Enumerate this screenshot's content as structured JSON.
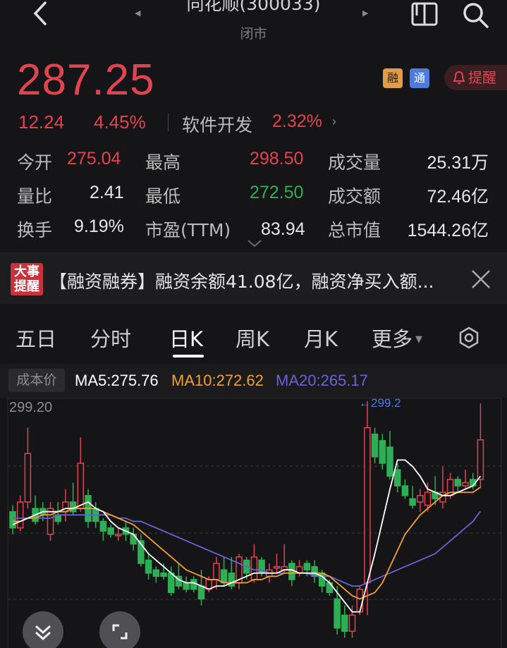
{
  "header": {
    "title": "同花顺(300033)",
    "status": "闭市"
  },
  "quote": {
    "price": "287.25",
    "change": "12.24",
    "change_pct": "4.45%",
    "industry": "软件开发",
    "industry_pct": "2.32%",
    "industry_arrow": "›",
    "tags": {
      "margin": "融",
      "connect": "通"
    },
    "remind_label": "提醒"
  },
  "stats": {
    "open_label": "今开",
    "open": "275.04",
    "high_label": "最高",
    "high": "298.50",
    "volume_label": "成交量",
    "volume": "25.31万",
    "vol_ratio_label": "量比",
    "vol_ratio": "2.41",
    "low_label": "最低",
    "low": "272.50",
    "amount_label": "成交额",
    "amount": "72.46亿",
    "turnover_label": "换手",
    "turnover": "9.19%",
    "pe_label": "市盈(TTM)",
    "pe": "83.94",
    "mcap_label": "总市值",
    "mcap": "1544.26亿"
  },
  "notice": {
    "badge_line1": "大事",
    "badge_line2": "提醒",
    "text": "【融资融券】融资余额41.08亿，融资净买入额..."
  },
  "tabs": [
    "五日",
    "分时",
    "日K",
    "周K",
    "月K",
    "更多"
  ],
  "indicators": {
    "cost_label": "成本价",
    "ma5": "MA5:275.76",
    "ma10": "MA10:272.62",
    "ma20": "MA20:265.17",
    "colors": {
      "ma5": "#ffffff",
      "ma10": "#f0a030",
      "ma20": "#6a62d8",
      "up": "#e14451",
      "down": "#2eae55"
    }
  },
  "chart_data": {
    "type": "candlestick",
    "y_top_label": "299.20",
    "high_marker": "299.2",
    "grid": true,
    "candles": [
      {
        "o": 265,
        "c": 260,
        "h": 267,
        "l": 258
      },
      {
        "o": 260,
        "c": 268,
        "h": 270,
        "l": 259
      },
      {
        "o": 268,
        "c": 283,
        "h": 291,
        "l": 266
      },
      {
        "o": 266,
        "c": 262,
        "h": 270,
        "l": 261
      },
      {
        "o": 266,
        "c": 264,
        "h": 268,
        "l": 262
      },
      {
        "o": 258,
        "c": 266,
        "h": 268,
        "l": 256
      },
      {
        "o": 264,
        "c": 262,
        "h": 268,
        "l": 261
      },
      {
        "o": 265,
        "c": 268,
        "h": 272,
        "l": 262
      },
      {
        "o": 268,
        "c": 265,
        "h": 274,
        "l": 264
      },
      {
        "o": 266,
        "c": 280,
        "h": 288,
        "l": 265
      },
      {
        "o": 270,
        "c": 262,
        "h": 272,
        "l": 260
      },
      {
        "o": 266,
        "c": 262,
        "h": 268,
        "l": 260
      },
      {
        "o": 262,
        "c": 259,
        "h": 263,
        "l": 256
      },
      {
        "o": 260,
        "c": 258,
        "h": 261,
        "l": 257
      },
      {
        "o": 258,
        "c": 258,
        "h": 260,
        "l": 256
      },
      {
        "o": 260,
        "c": 258,
        "h": 262,
        "l": 256
      },
      {
        "o": 258,
        "c": 255,
        "h": 260,
        "l": 253
      },
      {
        "o": 256,
        "c": 249,
        "h": 258,
        "l": 248
      },
      {
        "o": 250,
        "c": 246,
        "h": 252,
        "l": 244
      },
      {
        "o": 247,
        "c": 245,
        "h": 248,
        "l": 243
      },
      {
        "o": 246,
        "c": 245,
        "h": 249,
        "l": 244
      },
      {
        "o": 246,
        "c": 240,
        "h": 248,
        "l": 239
      },
      {
        "o": 245,
        "c": 242,
        "h": 249,
        "l": 241
      },
      {
        "o": 243,
        "c": 241,
        "h": 245,
        "l": 240
      },
      {
        "o": 244,
        "c": 241,
        "h": 245,
        "l": 240
      },
      {
        "o": 242,
        "c": 238,
        "h": 247,
        "l": 236
      },
      {
        "o": 241,
        "c": 244,
        "h": 245,
        "l": 240
      },
      {
        "o": 244,
        "c": 249,
        "h": 251,
        "l": 241
      },
      {
        "o": 247,
        "c": 243,
        "h": 251,
        "l": 242
      },
      {
        "o": 246,
        "c": 242,
        "h": 251,
        "l": 241
      },
      {
        "o": 243,
        "c": 251,
        "h": 252,
        "l": 241
      },
      {
        "o": 250,
        "c": 246,
        "h": 251,
        "l": 244
      },
      {
        "o": 244,
        "c": 251,
        "h": 255,
        "l": 243
      },
      {
        "o": 250,
        "c": 246,
        "h": 251,
        "l": 245
      },
      {
        "o": 245,
        "c": 247,
        "h": 249,
        "l": 243
      },
      {
        "o": 248,
        "c": 248,
        "h": 252,
        "l": 246
      },
      {
        "o": 247,
        "c": 248,
        "h": 255,
        "l": 246
      },
      {
        "o": 249,
        "c": 244,
        "h": 250,
        "l": 242
      },
      {
        "o": 246,
        "c": 248,
        "h": 250,
        "l": 245
      },
      {
        "o": 249,
        "c": 247,
        "h": 250,
        "l": 245
      },
      {
        "o": 248,
        "c": 245,
        "h": 250,
        "l": 243
      },
      {
        "o": 246,
        "c": 242,
        "h": 247,
        "l": 240
      },
      {
        "o": 243,
        "c": 240,
        "h": 244,
        "l": 239
      },
      {
        "o": 238,
        "c": 229,
        "h": 242,
        "l": 227
      },
      {
        "o": 233,
        "c": 228,
        "h": 236,
        "l": 226
      },
      {
        "o": 228,
        "c": 233,
        "h": 236,
        "l": 226
      },
      {
        "o": 234,
        "c": 241,
        "h": 242,
        "l": 233
      },
      {
        "o": 243,
        "c": 291,
        "h": 299.2,
        "l": 233
      },
      {
        "o": 289,
        "c": 282,
        "h": 291,
        "l": 280
      },
      {
        "o": 287,
        "c": 280,
        "h": 289,
        "l": 278
      },
      {
        "o": 285,
        "c": 276,
        "h": 290,
        "l": 275
      },
      {
        "o": 278,
        "c": 273,
        "h": 280,
        "l": 271
      },
      {
        "o": 273,
        "c": 270,
        "h": 275,
        "l": 269
      },
      {
        "o": 269,
        "c": 267,
        "h": 273,
        "l": 266
      },
      {
        "o": 268,
        "c": 270,
        "h": 272,
        "l": 265
      },
      {
        "o": 267,
        "c": 271,
        "h": 274,
        "l": 265
      },
      {
        "o": 271,
        "c": 269,
        "h": 276,
        "l": 267
      },
      {
        "o": 268,
        "c": 271,
        "h": 279,
        "l": 266
      },
      {
        "o": 270,
        "c": 275,
        "h": 277,
        "l": 269
      },
      {
        "o": 275,
        "c": 273,
        "h": 276,
        "l": 271
      },
      {
        "o": 273,
        "c": 274,
        "h": 278,
        "l": 272
      },
      {
        "o": 275,
        "c": 273,
        "h": 277,
        "l": 272
      },
      {
        "o": 275,
        "c": 287.25,
        "h": 298.5,
        "l": 272.5
      }
    ],
    "ma5": [
      261,
      262,
      263,
      264,
      265,
      265,
      265,
      266,
      266,
      267,
      268,
      266,
      265,
      262,
      260,
      259,
      258,
      255,
      252,
      250,
      248,
      246,
      244,
      243,
      243,
      242,
      241,
      242,
      242,
      243,
      244,
      245,
      246,
      246,
      246,
      246,
      247,
      247,
      246,
      246,
      246,
      245,
      243,
      240,
      237,
      234,
      234,
      243,
      252,
      262,
      272,
      281,
      281,
      279,
      276,
      272,
      271,
      270,
      270,
      271,
      272,
      273,
      276
    ],
    "ma10": [
      262,
      262,
      263,
      263,
      264,
      264,
      265,
      265,
      266,
      266,
      266,
      266,
      265,
      264,
      263,
      262,
      261,
      259,
      257,
      255,
      253,
      251,
      249,
      247,
      246,
      245,
      244,
      244,
      243,
      243,
      243,
      243,
      244,
      244,
      245,
      245,
      246,
      246,
      246,
      246,
      246,
      246,
      245,
      243,
      241,
      239,
      238,
      239,
      240,
      243,
      248,
      253,
      258,
      261,
      264,
      266,
      268,
      270,
      271,
      271,
      271,
      271,
      272.6
    ],
    "ma20": [
      263,
      263,
      263,
      263,
      263,
      263,
      264,
      264,
      264,
      264,
      264,
      264,
      264,
      264,
      263,
      263,
      262,
      262,
      261,
      260,
      259,
      258,
      257,
      256,
      255,
      254,
      253,
      252,
      251,
      250,
      249,
      248,
      247,
      247,
      246,
      246,
      246,
      246,
      246,
      246,
      245,
      245,
      245,
      244,
      243,
      242,
      242,
      243,
      244,
      245,
      246,
      247,
      248,
      249,
      250,
      251,
      252,
      254,
      256,
      258,
      260,
      262,
      265.17
    ]
  }
}
